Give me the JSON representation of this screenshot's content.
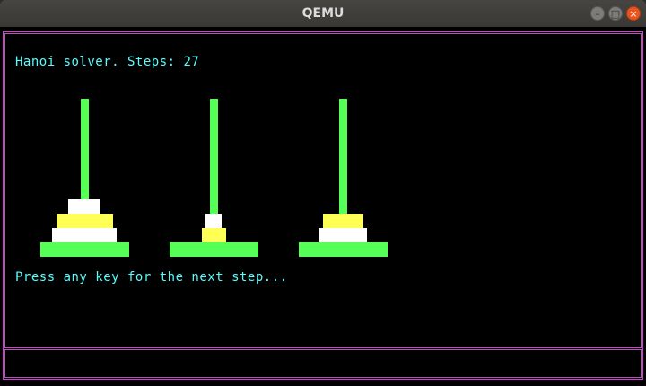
{
  "window": {
    "title": "QEMU",
    "buttons": {
      "minimize_icon": "minimize-icon",
      "maximize_icon": "maximize-icon",
      "close_icon": "close-icon"
    }
  },
  "screen": {
    "header_line": "Hanoi solver. Steps: 27",
    "prompt_line": "Press any key for the next step...",
    "colors": {
      "text": "#55ffff",
      "peg": "#55ff55",
      "border": "#cc44cc",
      "disk_white": "#ffffff",
      "disk_yellow": "#ffff55"
    }
  },
  "towers": [
    {
      "peg": "peg-1",
      "disks_top_to_bottom": [
        "white",
        "yellow",
        "white"
      ]
    },
    {
      "peg": "peg-2",
      "disks_top_to_bottom": [
        "white",
        "yellow"
      ]
    },
    {
      "peg": "peg-3",
      "disks_top_to_bottom": [
        "yellow",
        "white"
      ]
    }
  ]
}
